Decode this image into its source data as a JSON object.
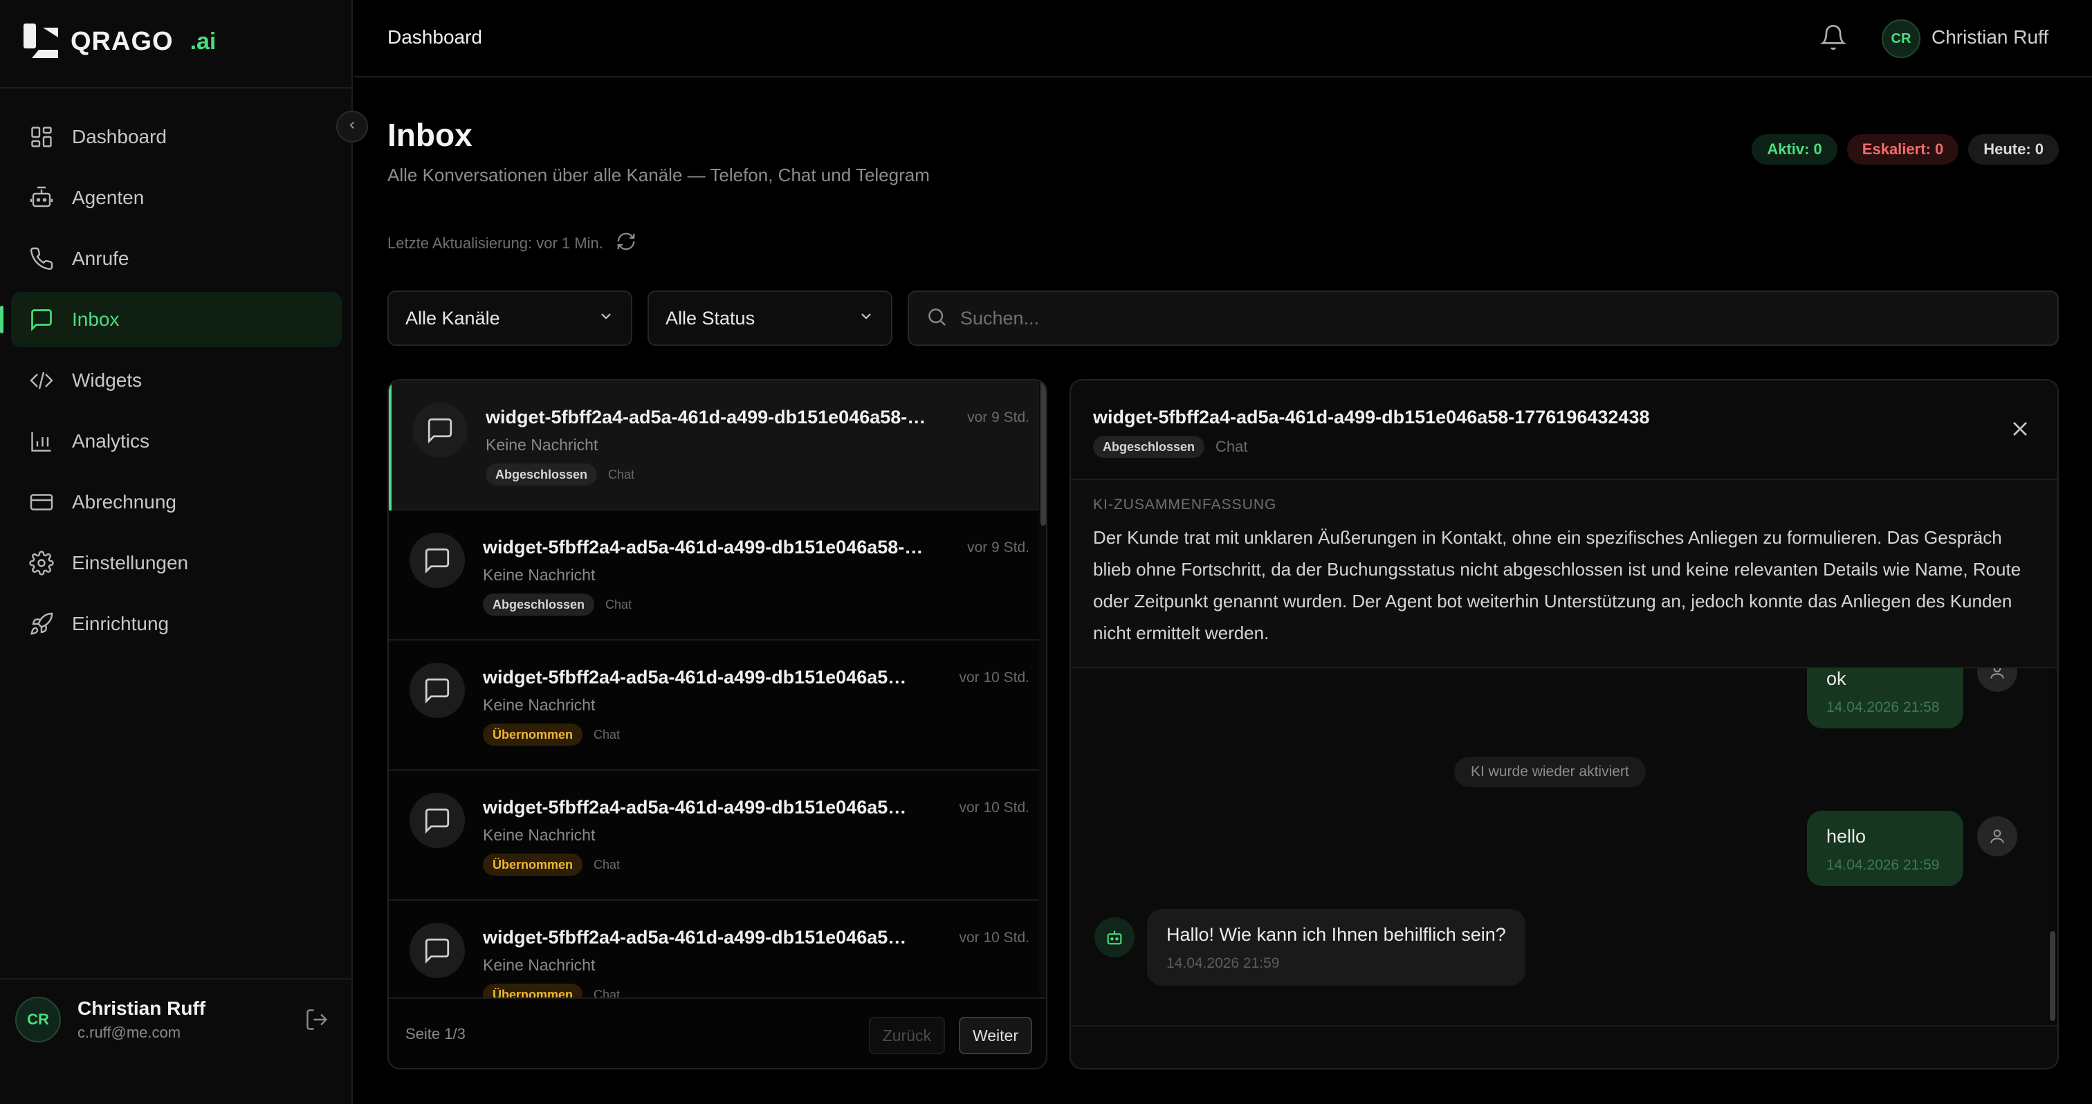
{
  "brand": {
    "name": "QRAGO",
    "suffix": ".ai"
  },
  "sidebar": {
    "items": [
      {
        "label": "Dashboard",
        "icon": "dashboard-icon",
        "active": false
      },
      {
        "label": "Agenten",
        "icon": "robot-icon",
        "active": false
      },
      {
        "label": "Anrufe",
        "icon": "phone-icon",
        "active": false
      },
      {
        "label": "Inbox",
        "icon": "message-icon",
        "active": true
      },
      {
        "label": "Widgets",
        "icon": "code-icon",
        "active": false
      },
      {
        "label": "Analytics",
        "icon": "bar-chart-icon",
        "active": false
      },
      {
        "label": "Abrechnung",
        "icon": "credit-card-icon",
        "active": false
      },
      {
        "label": "Einstellungen",
        "icon": "gear-icon",
        "active": false
      },
      {
        "label": "Einrichtung",
        "icon": "rocket-icon",
        "active": false
      }
    ],
    "user": {
      "initials": "CR",
      "name": "Christian Ruff",
      "email": "c.ruff@me.com"
    }
  },
  "topbar": {
    "title": "Dashboard",
    "user_initials": "CR",
    "user_name": "Christian Ruff"
  },
  "header": {
    "title": "Inbox",
    "subtitle": "Alle Konversationen über alle Kanäle — Telefon, Chat und Telegram",
    "last_update": "Letzte Aktualisierung: vor 1 Min.",
    "stats": {
      "active": "Aktiv: 0",
      "escalated": "Eskaliert: 0",
      "today": "Heute: 0"
    }
  },
  "filters": {
    "channel": "Alle Kanäle",
    "status": "Alle Status",
    "search_placeholder": "Suchen..."
  },
  "conversations": [
    {
      "title": "widget-5fbff2a4-ad5a-461d-a499-db151e046a58-17...",
      "time": "vor 9 Std.",
      "preview": "Keine Nachricht",
      "status": "Abgeschlossen",
      "channel": "Chat"
    },
    {
      "title": "widget-5fbff2a4-ad5a-461d-a499-db151e046a58-17...",
      "time": "vor 9 Std.",
      "preview": "Keine Nachricht",
      "status": "Abgeschlossen",
      "channel": "Chat"
    },
    {
      "title": "widget-5fbff2a4-ad5a-461d-a499-db151e046a58-1...",
      "time": "vor 10 Std.",
      "preview": "Keine Nachricht",
      "status": "Übernommen",
      "channel": "Chat"
    },
    {
      "title": "widget-5fbff2a4-ad5a-461d-a499-db151e046a58-1...",
      "time": "vor 10 Std.",
      "preview": "Keine Nachricht",
      "status": "Übernommen",
      "channel": "Chat"
    },
    {
      "title": "widget-5fbff2a4-ad5a-461d-a499-db151e046a58-1...",
      "time": "vor 10 Std.",
      "preview": "Keine Nachricht",
      "status": "Übernommen",
      "channel": "Chat"
    }
  ],
  "pagination": {
    "info": "Seite 1/3",
    "prev": "Zurück",
    "next": "Weiter"
  },
  "detail": {
    "title": "widget-5fbff2a4-ad5a-461d-a499-db151e046a58-1776196432438",
    "status": "Abgeschlossen",
    "channel": "Chat",
    "summary_label": "KI-ZUSAMMENFASSUNG",
    "summary": "Der Kunde trat mit unklaren Äußerungen in Kontakt, ohne ein spezifisches Anliegen zu formulieren. Das Gespräch blieb ohne Fortschritt, da der Buchungsstatus nicht abgeschlossen ist und keine relevanten Details wie Name, Route oder Zeitpunkt genannt wurden. Der Agent bot weiterhin Unterstützung an, jedoch konnte das Anliegen des Kunden nicht ermittelt werden.",
    "messages": [
      {
        "role": "user",
        "text": "ok",
        "time": "14.04.2026 21:58"
      },
      {
        "role": "system",
        "text": "KI wurde wieder aktiviert"
      },
      {
        "role": "user",
        "text": "hello",
        "time": "14.04.2026 21:59"
      },
      {
        "role": "bot",
        "text": "Hallo! Wie kann ich Ihnen behilflich sein?",
        "time": "14.04.2026 21:59"
      }
    ]
  },
  "colors": {
    "accent": "#4ade80",
    "danger": "#f26b6b",
    "warning": "#f1b534",
    "background": "#000000"
  }
}
